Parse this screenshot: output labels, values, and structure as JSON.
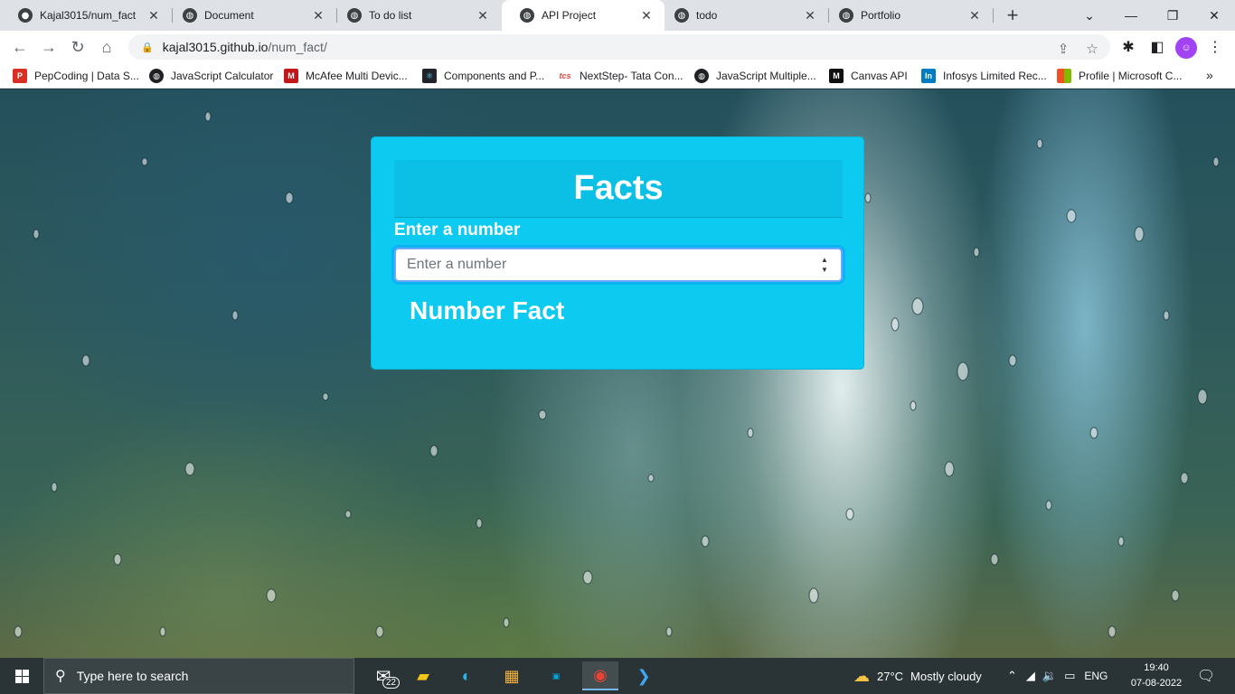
{
  "browser": {
    "tabs": [
      {
        "title": "Kajal3015/num_fact",
        "icon": "github-icon",
        "active": false
      },
      {
        "title": "Document",
        "icon": "globe-icon",
        "active": false
      },
      {
        "title": "To do list",
        "icon": "globe-icon",
        "active": false
      },
      {
        "title": "API Project",
        "icon": "globe-icon",
        "active": true
      },
      {
        "title": "todo",
        "icon": "globe-icon",
        "active": false
      },
      {
        "title": "Portfolio",
        "icon": "globe-icon",
        "active": false
      }
    ],
    "url_host": "kajal3015.github.io",
    "url_path": "/num_fact/",
    "bookmarks": [
      {
        "label": "PepCoding | Data S...",
        "icon": "pepcoding-icon",
        "color": "#d93025"
      },
      {
        "label": "JavaScript Calculator",
        "icon": "globe-icon",
        "color": "#202124"
      },
      {
        "label": "McAfee Multi Devic...",
        "icon": "mcafee-icon",
        "color": "#c01818"
      },
      {
        "label": "Components and P...",
        "icon": "react-icon",
        "color": "#20232a"
      },
      {
        "label": "NextStep- Tata Con...",
        "icon": "tcs-icon",
        "color": "#e8483d"
      },
      {
        "label": "JavaScript Multiple...",
        "icon": "globe-icon",
        "color": "#202124"
      },
      {
        "label": "Canvas API",
        "icon": "mdn-icon",
        "color": "#111111"
      },
      {
        "label": "Infosys Limited Rec...",
        "icon": "infosys-icon",
        "color": "#007cc3"
      },
      {
        "label": "Profile | Microsoft C...",
        "icon": "microsoft-icon",
        "color": "#f25022"
      }
    ]
  },
  "page": {
    "card_title": "Facts",
    "input_label": "Enter a number",
    "input_placeholder": "Enter a number",
    "input_value": "",
    "fact_heading": "Number Fact",
    "card_color": "#0dcaf0"
  },
  "taskbar": {
    "search_placeholder": "Type here to search",
    "mail_badge": "22",
    "weather_temp": "27°C",
    "weather_text": "Mostly cloudy",
    "language": "ENG",
    "time": "19:40",
    "date": "07-08-2022"
  }
}
